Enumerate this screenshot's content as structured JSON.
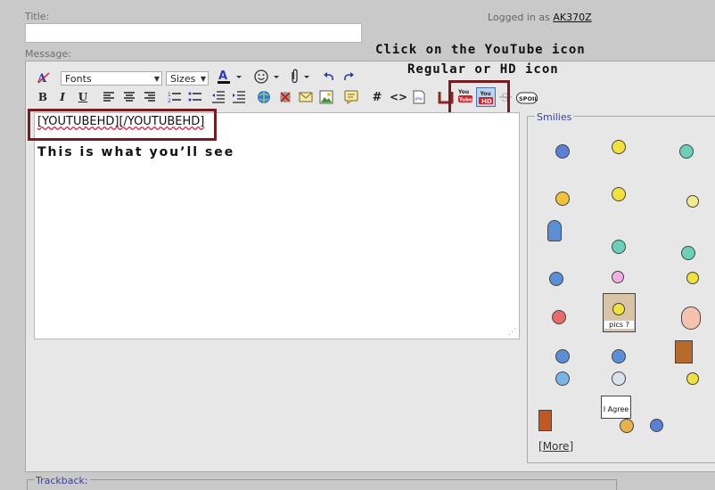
{
  "form": {
    "title_label": "Title:",
    "message_label": "Message:",
    "logged_prefix": "Logged in as",
    "username": "AK370Z"
  },
  "annotations": {
    "line1": "Click on the YouTube icon",
    "line2": "Regular or HD icon",
    "see": "This is what you’ll see"
  },
  "toolbar": {
    "fonts": "Fonts",
    "sizes": "Sizes",
    "youtube_label": "You Tube",
    "youtube_hd_top": "You",
    "youtube_hd_bottom": "HD",
    "spoil": "SPOIL"
  },
  "editor": {
    "content": "[YOUTUBEHD][/YOUTUBEHD]"
  },
  "smilies": {
    "legend": "Smilies",
    "pics_label": "pics ?",
    "agree_label": "I Agree",
    "more": "More"
  },
  "footer": {
    "trackback": "Trackback:"
  }
}
